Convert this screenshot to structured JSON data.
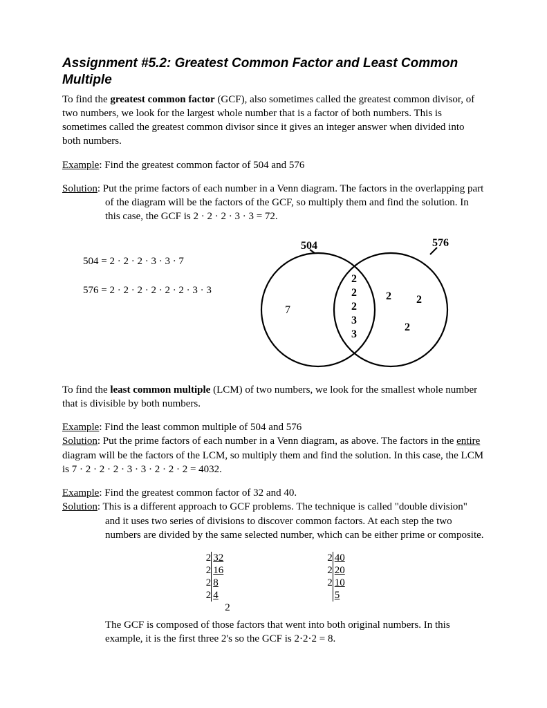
{
  "title": "Assignment #5.2: Greatest Common Factor and Least Common Multiple",
  "intro": {
    "p1a": "To find the ",
    "p1b": "greatest common factor",
    "p1c": " (GCF), also sometimes called the greatest common divisor, of two numbers, we look for the largest whole number that is a factor of both numbers.  This is sometimes called the greatest common divisor since it gives an integer answer when divided into both numbers."
  },
  "ex1": {
    "label": "Example",
    "text": ":  Find the greatest common factor of 504 and 576"
  },
  "sol1": {
    "label": "Solution",
    "text": ":  Put the prime factors of each number in a Venn diagram.  The factors in the overlapping part of the diagram will be the factors of the GCF, so multiply them and find the solution. In this case, the GCF is 2 · 2 · 2 · 3 · 3 = 72."
  },
  "factor504": "504 = 2 · 2 · 2 · 3 · 3 · 7",
  "factor576": "576 = 2 · 2 · 2 · 2 · 2 · 2 · 3 · 3",
  "venn": {
    "label504": "504",
    "label576": "576",
    "left": "7",
    "center": [
      "2",
      "2",
      "2",
      "3",
      "3"
    ],
    "rightA": "2",
    "rightB": "2",
    "rightC": "2"
  },
  "lcm": {
    "p1a": "To find the ",
    "p1b": "least common multiple",
    "p1c": " (LCM) of two numbers, we look for the smallest whole number that is divisible by both numbers."
  },
  "ex2": {
    "label": "Example",
    "text": ":  Find the least common multiple of 504 and 576"
  },
  "sol2": {
    "label": "Solution",
    "text_a": ":  Put the prime factors of each number in a Venn diagram, as above.  The factors in the ",
    "entire": "entire",
    "text_b": " diagram will be the factors of the LCM, so multiply them and find the solution. In this case, the LCM is 7 · 2 · 2 · 2 · 3 · 3 · 2 · 2 · 2 = 4032."
  },
  "ex3": {
    "label": "Example",
    "text": ":  Find the greatest common factor of 32 and 40."
  },
  "sol3": {
    "label": "Solution",
    "text": ":  This is a different approach to GCF problems.  The technique is called \"double division\" and it uses two series of divisions to discover common factors.  At each step the two numbers are divided by the same selected number, which can be either prime or composite."
  },
  "division": {
    "left": [
      {
        "d": "2",
        "n": "32"
      },
      {
        "d": "2",
        "n": "16"
      },
      {
        "d": "2",
        "n": "8"
      },
      {
        "d": "2",
        "n": "4"
      }
    ],
    "leftFinal": "2",
    "right": [
      {
        "d": "2",
        "n": "40"
      },
      {
        "d": "2",
        "n": "20"
      },
      {
        "d": "2",
        "n": "10"
      },
      {
        "d": "",
        "n": "5"
      }
    ]
  },
  "conclusion": "The GCF is composed of those factors that went into both original numbers.  In this example, it is the first three 2's so the GCF is 2·2·2 = 8."
}
